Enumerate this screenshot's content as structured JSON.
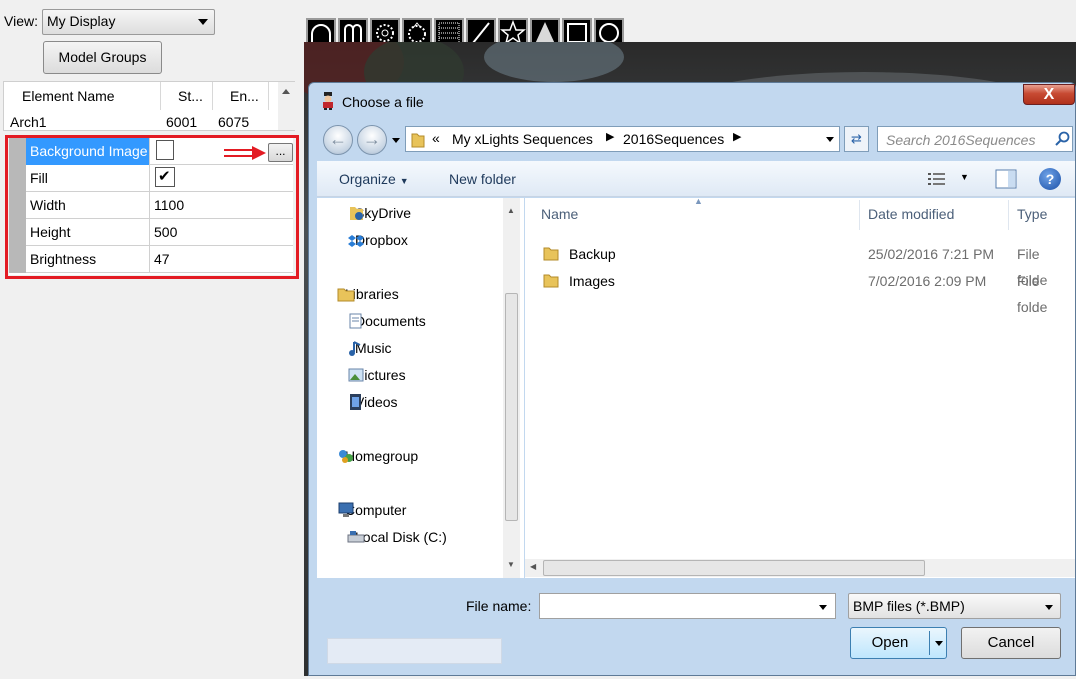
{
  "left_panel": {
    "view_label": "View:",
    "view_value": "My Display",
    "model_groups_button": "Model Groups",
    "grid": {
      "headers": [
        "Element Name",
        "St...",
        "En..."
      ],
      "row": [
        "Arch1",
        "6001",
        "6075"
      ]
    },
    "properties": [
      {
        "name": "Background Image",
        "value": ""
      },
      {
        "name": "Fill",
        "value": "✔"
      },
      {
        "name": "Width",
        "value": "1100"
      },
      {
        "name": "Height",
        "value": "500"
      },
      {
        "name": "Brightness",
        "value": "47"
      }
    ],
    "ellipsis_button": "..."
  },
  "toolbar": {
    "tools": [
      "arch-icon",
      "candy-cane-icon",
      "spinner-icon",
      "star-wreath-icon",
      "matrix-icon",
      "line-icon",
      "star-icon",
      "tree-icon",
      "square-icon",
      "circle-icon"
    ]
  },
  "dialog": {
    "title": "Choose a file",
    "close_symbol": "X",
    "address": {
      "chevron": "«",
      "crumbs": [
        "My xLights Sequences",
        "2016Sequences"
      ]
    },
    "search_placeholder": "Search 2016Sequences",
    "commands": {
      "organize": "Organize",
      "new_folder": "New folder",
      "help": "?"
    },
    "nav_items": [
      {
        "label": "SkyDrive",
        "icon": "skydrive-icon"
      },
      {
        "label": "Dropbox",
        "icon": "dropbox-icon"
      },
      {
        "label": "Libraries",
        "icon": "libraries-icon"
      },
      {
        "label": "Documents",
        "icon": "documents-icon"
      },
      {
        "label": "Music",
        "icon": "music-icon"
      },
      {
        "label": "Pictures",
        "icon": "pictures-icon"
      },
      {
        "label": "Videos",
        "icon": "videos-icon"
      },
      {
        "label": "Homegroup",
        "icon": "homegroup-icon"
      },
      {
        "label": "Computer",
        "icon": "computer-icon"
      },
      {
        "label": "Local Disk (C:)",
        "icon": "drive-icon"
      }
    ],
    "columns": {
      "name": "Name",
      "date": "Date modified",
      "type": "Type"
    },
    "files": [
      {
        "name": "Backup",
        "date": "25/02/2016 7:21 PM",
        "type": "File folde"
      },
      {
        "name": "Images",
        "date": "7/02/2016 2:09 PM",
        "type": "File folde"
      }
    ],
    "file_name_label": "File name:",
    "file_name_value": "",
    "filter": "BMP files (*.BMP)",
    "open_button": "Open",
    "cancel_button": "Cancel"
  },
  "colors": {
    "highlight": "#e31b23",
    "selection": "#3399ff"
  }
}
